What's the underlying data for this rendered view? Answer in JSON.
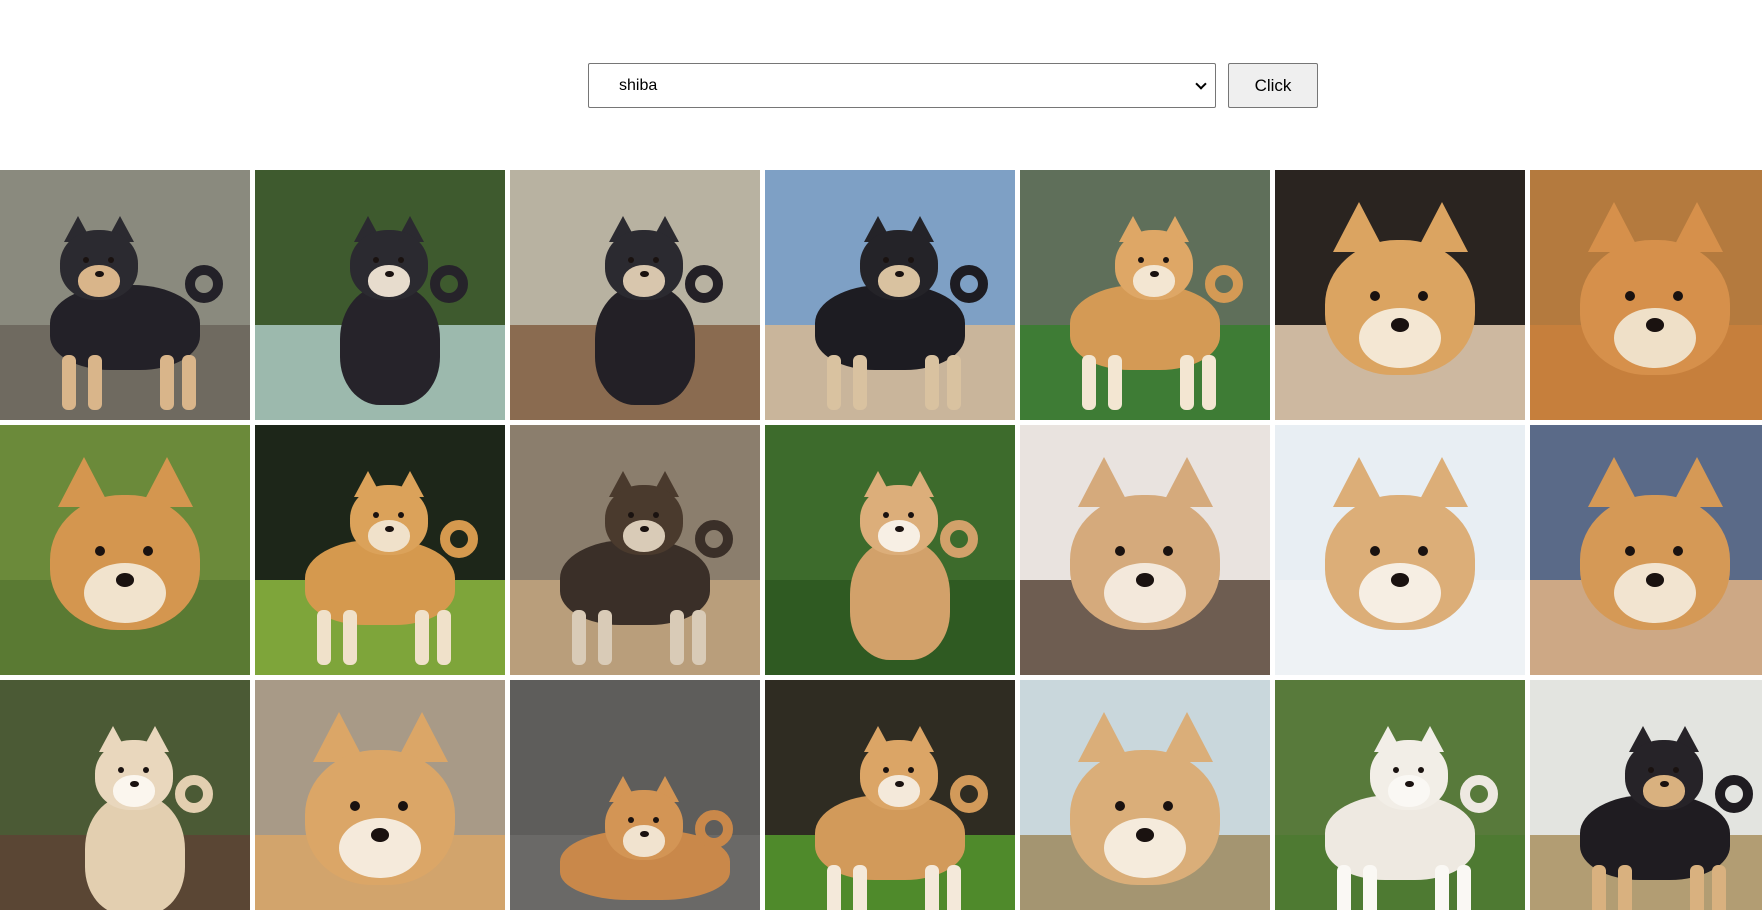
{
  "breed_select": {
    "selected": "shiba"
  },
  "go_button": {
    "label": "Click"
  },
  "gallery": {
    "photos": [
      {
        "bg": "#8a8a7e",
        "ground": "#6f6a60",
        "coat": "#232128",
        "face": "#2b2a30",
        "mask": "#d9b58a",
        "alt_layout": "run"
      },
      {
        "bg": "#3e5a2e",
        "ground": "#9cb9ad",
        "coat": "#26232a",
        "face": "#2b2a30",
        "mask": "#e7dccd",
        "alt_layout": "sit"
      },
      {
        "bg": "#b8b2a1",
        "ground": "#8a6b50",
        "coat": "#232026",
        "face": "#2b2a30",
        "mask": "#d8c6ad",
        "alt_layout": "sit"
      },
      {
        "bg": "#7ea0c5",
        "ground": "#c9b59b",
        "coat": "#1d1c22",
        "face": "#242328",
        "mask": "#d9c2a0",
        "alt_layout": "stand"
      },
      {
        "bg": "#5f6f5a",
        "ground": "#3e7c35",
        "coat": "#d49a55",
        "face": "#dea766",
        "mask": "#f3e6d2",
        "alt_layout": "stand"
      },
      {
        "bg": "#2a2420",
        "ground": "#cdb8a0",
        "coat": "#d39a54",
        "face": "#dba461",
        "mask": "#f4e7d3",
        "alt_layout": "face"
      },
      {
        "bg": "#b47a3e",
        "ground": "#c67f3c",
        "coat": "#cd8440",
        "face": "#d6904b",
        "mask": "#efe0c8",
        "alt_layout": "face"
      },
      {
        "bg": "#6b8a3a",
        "ground": "#5a7a33",
        "coat": "#cc8a46",
        "face": "#d4964f",
        "mask": "#f1e3cd",
        "alt_layout": "face"
      },
      {
        "bg": "#1d2619",
        "ground": "#7ea53a",
        "coat": "#d5994e",
        "face": "#dba25a",
        "mask": "#f0e1ca",
        "alt_layout": "stand"
      },
      {
        "bg": "#8b7e6d",
        "ground": "#b99e7b",
        "coat": "#3a2f28",
        "face": "#4a3a2d",
        "mask": "#d9cbb7",
        "alt_layout": "stand"
      },
      {
        "bg": "#3d6b2c",
        "ground": "#2f5a22",
        "coat": "#d2a16a",
        "face": "#dcae7a",
        "mask": "#f7efe4",
        "alt_layout": "sit"
      },
      {
        "bg": "#e9e3df",
        "ground": "#6e5d51",
        "coat": "#c79a6b",
        "face": "#d5aa7c",
        "mask": "#f3e8db",
        "alt_layout": "face"
      },
      {
        "bg": "#e8eef3",
        "ground": "#eef2f5",
        "coat": "#d6a46c",
        "face": "#dcae78",
        "mask": "#f6eee3",
        "alt_layout": "face"
      },
      {
        "bg": "#5a6a88",
        "ground": "#cda885",
        "coat": "#c98a49",
        "face": "#d59956",
        "mask": "#f2e4d0",
        "alt_layout": "face"
      },
      {
        "bg": "#4b5a35",
        "ground": "#5a4634",
        "coat": "#e3cfb0",
        "face": "#e9d7bd",
        "mask": "#fbf6ee",
        "alt_layout": "sit"
      },
      {
        "bg": "#a89a87",
        "ground": "#d2a46c",
        "coat": "#d49a5a",
        "face": "#dba667",
        "mask": "#f5eadb",
        "alt_layout": "face"
      },
      {
        "bg": "#5e5d5b",
        "ground": "#6a6967",
        "coat": "#c9884a",
        "face": "#d39555",
        "mask": "#f1e3cf",
        "alt_layout": "lie"
      },
      {
        "bg": "#2f2c22",
        "ground": "#4f8a2b",
        "coat": "#d29a5a",
        "face": "#dba566",
        "mask": "#f4e9da",
        "alt_layout": "stand"
      },
      {
        "bg": "#c9d7dc",
        "ground": "#a49571",
        "coat": "#d2a56e",
        "face": "#daae79",
        "mask": "#f5ebdc",
        "alt_layout": "face"
      },
      {
        "bg": "#587a3b",
        "ground": "#4e7a32",
        "coat": "#eee9e1",
        "face": "#f2eee7",
        "mask": "#faf8f4",
        "alt_layout": "stand"
      },
      {
        "bg": "#e3e4e0",
        "ground": "#b29d73",
        "coat": "#1f1c21",
        "face": "#262328",
        "mask": "#d9b17f",
        "alt_layout": "stand"
      }
    ]
  }
}
